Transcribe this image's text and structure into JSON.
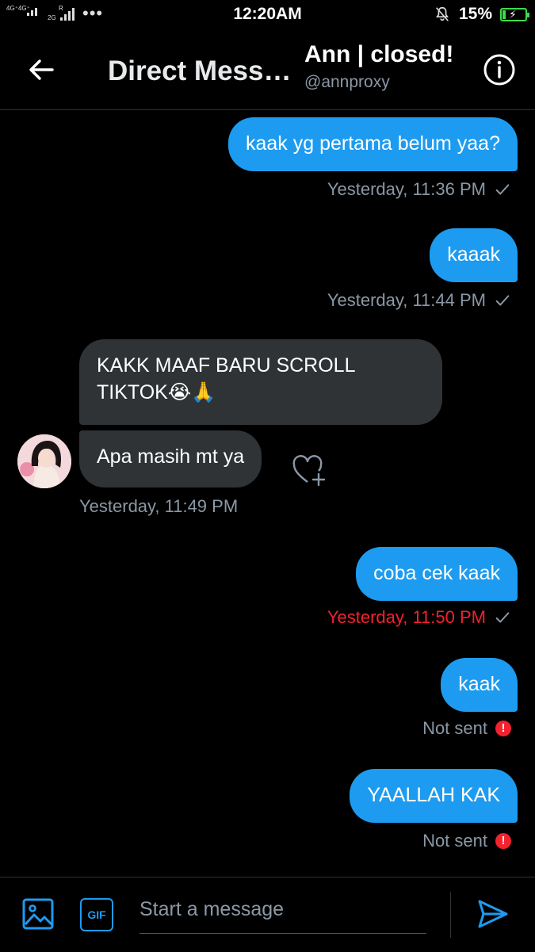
{
  "status_bar": {
    "network_1": "4G⁺4G⁺",
    "network_2": "R",
    "network_3": "2G",
    "time": "12:20AM",
    "battery": "15%",
    "battery_level": 0.15
  },
  "header": {
    "title": "Direct Mess…",
    "contact_name": "Ann | closed!",
    "contact_handle": "@annproxy"
  },
  "messages": [
    {
      "text": "kaak yg pertama belum yaa?",
      "meta": "Yesterday, 11:36 PM"
    },
    {
      "text": "kaaak",
      "meta": "Yesterday, 11:44 PM"
    },
    {
      "text_line1": "KAKK MAAF BARU SCROLL",
      "text_line2": "TIKTOK😭🙏"
    },
    {
      "text": "Apa masih mt ya",
      "meta": "Yesterday, 11:49 PM"
    },
    {
      "text": "coba cek kaak",
      "meta": "Yesterday, 11:50 PM"
    },
    {
      "text": "kaak",
      "meta": "Not sent"
    },
    {
      "text": "YAALLAH KAK",
      "meta": "Not sent"
    }
  ],
  "composer": {
    "gif_label": "GIF",
    "placeholder": "Start a message"
  },
  "colors": {
    "accent": "#1d9bf0",
    "error": "#f4212e",
    "received_bubble": "#2f3336"
  }
}
